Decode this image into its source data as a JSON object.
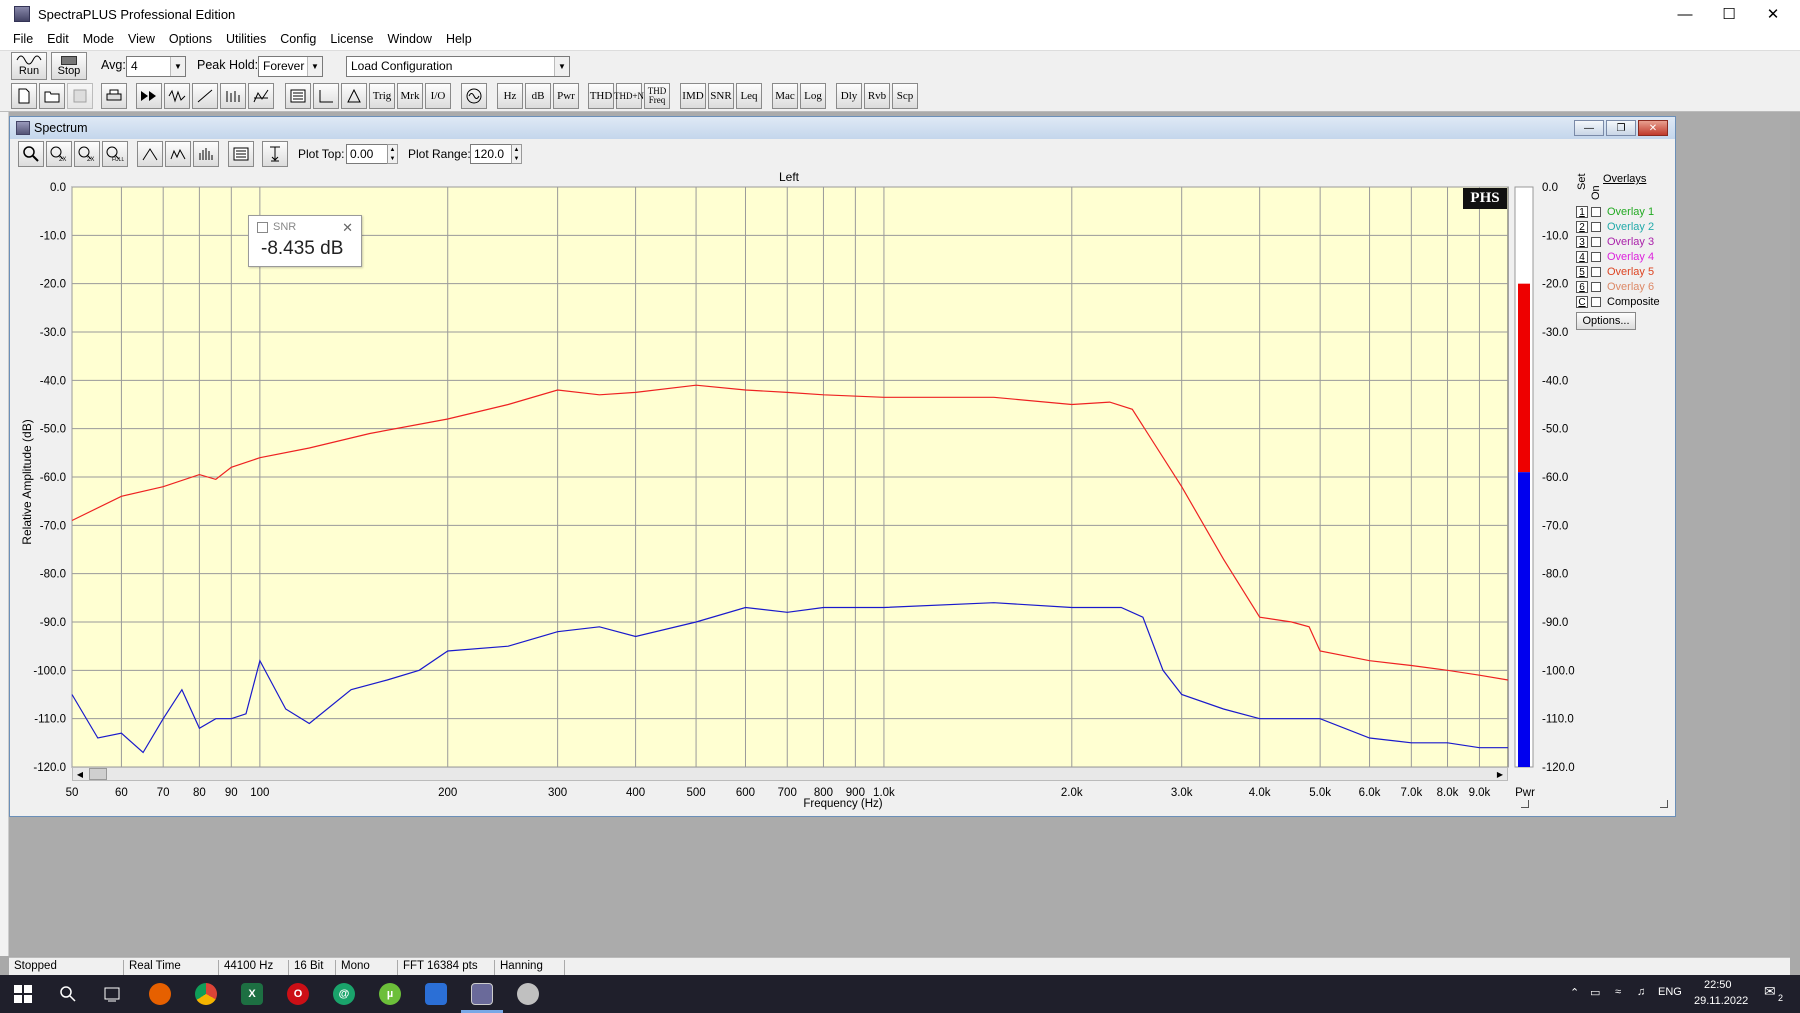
{
  "window": {
    "title": "SpectraPLUS Professional Edition"
  },
  "menu": [
    "File",
    "Edit",
    "Mode",
    "View",
    "Options",
    "Utilities",
    "Config",
    "License",
    "Window",
    "Help"
  ],
  "toolbar1": {
    "run_label": "Run",
    "stop_label": "Stop",
    "avg_label": "Avg:",
    "avg_value": "4",
    "peak_hold_label": "Peak Hold:",
    "peak_hold_value": "Forever",
    "config_value": "Load Configuration"
  },
  "toolbar2": {
    "text_buttons": [
      "Trig",
      "Mrk",
      "I/O",
      "Hz",
      "dB",
      "Pwr",
      "THD",
      "THD+N",
      "THD Freq",
      "IMD",
      "SNR",
      "Leq",
      "Mac",
      "Log",
      "Dly",
      "Rvb",
      "Scp"
    ]
  },
  "spectrum_window": {
    "title": "Spectrum",
    "plot_top_label": "Plot Top:",
    "plot_top_value": "0.00",
    "plot_range_label": "Plot Range:",
    "plot_range_value": "120.0"
  },
  "snr_popup": {
    "title": "SNR",
    "value": "-8.435 dB"
  },
  "overlays": {
    "header": "Overlays",
    "set_label": "Set",
    "on_label": "On",
    "items": [
      {
        "num": "1",
        "label": "Overlay 1",
        "color": "#22aa22"
      },
      {
        "num": "2",
        "label": "Overlay 2",
        "color": "#22aaaa"
      },
      {
        "num": "3",
        "label": "Overlay 3",
        "color": "#aa22aa"
      },
      {
        "num": "4",
        "label": "Overlay 4",
        "color": "#dd22dd"
      },
      {
        "num": "5",
        "label": "Overlay 5",
        "color": "#dd4422"
      },
      {
        "num": "6",
        "label": "Overlay 6",
        "color": "#dd8866"
      },
      {
        "num": "C",
        "label": "Composite",
        "color": "#000000"
      }
    ],
    "options_label": "Options..."
  },
  "logo": "PHS",
  "chart_data": {
    "type": "line",
    "title": "Left",
    "xlabel": "Frequency (Hz)",
    "ylabel": "Relative Amplitude (dB)",
    "x_scale": "log",
    "xlim": [
      50,
      10000
    ],
    "ylim": [
      -120,
      0
    ],
    "grid": true,
    "x_ticks": [
      {
        "v": 50,
        "label": "50"
      },
      {
        "v": 60,
        "label": "60"
      },
      {
        "v": 70,
        "label": "70"
      },
      {
        "v": 80,
        "label": "80"
      },
      {
        "v": 90,
        "label": "90"
      },
      {
        "v": 100,
        "label": "100"
      },
      {
        "v": 200,
        "label": "200"
      },
      {
        "v": 300,
        "label": "300"
      },
      {
        "v": 400,
        "label": "400"
      },
      {
        "v": 500,
        "label": "500"
      },
      {
        "v": 600,
        "label": "600"
      },
      {
        "v": 700,
        "label": "700"
      },
      {
        "v": 800,
        "label": "800"
      },
      {
        "v": 900,
        "label": "900"
      },
      {
        "v": 1000,
        "label": "1.0k"
      },
      {
        "v": 2000,
        "label": "2.0k"
      },
      {
        "v": 3000,
        "label": "3.0k"
      },
      {
        "v": 4000,
        "label": "4.0k"
      },
      {
        "v": 5000,
        "label": "5.0k"
      },
      {
        "v": 6000,
        "label": "6.0k"
      },
      {
        "v": 7000,
        "label": "7.0k"
      },
      {
        "v": 8000,
        "label": "8.0k"
      },
      {
        "v": 9000,
        "label": "9.0k"
      }
    ],
    "y_ticks": [
      "0.0",
      "-10.0",
      "-20.0",
      "-30.0",
      "-40.0",
      "-50.0",
      "-60.0",
      "-70.0",
      "-80.0",
      "-90.0",
      "-100.0",
      "-110.0",
      "-120.0"
    ],
    "series": [
      {
        "color": "#ee2222",
        "x": [
          50,
          60,
          70,
          80,
          85,
          90,
          100,
          120,
          150,
          200,
          250,
          300,
          350,
          400,
          500,
          600,
          700,
          800,
          1000,
          1500,
          2000,
          2300,
          2500,
          3000,
          3500,
          4000,
          4500,
          4800,
          5000,
          6000,
          7000,
          8000,
          9000,
          10000
        ],
        "y": [
          -69,
          -64,
          -62,
          -59.5,
          -60.5,
          -58,
          -56,
          -54,
          -51,
          -48,
          -45,
          -42,
          -43,
          -42.5,
          -41,
          -42,
          -42.5,
          -43,
          -43.5,
          -43.5,
          -45,
          -44.5,
          -46,
          -62,
          -77,
          -89,
          -90,
          -91,
          -96,
          -98,
          -99,
          -100,
          -101,
          -102
        ]
      },
      {
        "color": "#1a1acc",
        "x": [
          50,
          55,
          60,
          65,
          70,
          75,
          80,
          85,
          90,
          95,
          100,
          110,
          120,
          140,
          160,
          180,
          200,
          250,
          300,
          350,
          400,
          500,
          600,
          700,
          800,
          1000,
          1500,
          2000,
          2400,
          2600,
          2800,
          3000,
          3500,
          4000,
          5000,
          6000,
          7000,
          8000,
          9000,
          10000
        ],
        "y": [
          -105,
          -114,
          -113,
          -117,
          -110,
          -104,
          -112,
          -110,
          -110,
          -109,
          -98,
          -108,
          -111,
          -104,
          -102,
          -100,
          -96,
          -95,
          -92,
          -91,
          -93,
          -90,
          -87,
          -88,
          -87,
          -87,
          -86,
          -87,
          -87,
          -89,
          -100,
          -105,
          -108,
          -110,
          -110,
          -114,
          -115,
          -115,
          -116,
          -116
        ]
      }
    ],
    "level_bar": {
      "label": "Pwr",
      "red_top_db": -20,
      "blue_top_db": -59,
      "bottom_db": -120
    }
  },
  "status": [
    "Stopped",
    "Real Time",
    "44100 Hz",
    "16 Bit",
    "Mono",
    "FFT 16384 pts",
    "Hanning"
  ],
  "taskbar": {
    "lang": "ENG",
    "time": "22:50",
    "date": "29.11.2022",
    "notifications": "2"
  }
}
